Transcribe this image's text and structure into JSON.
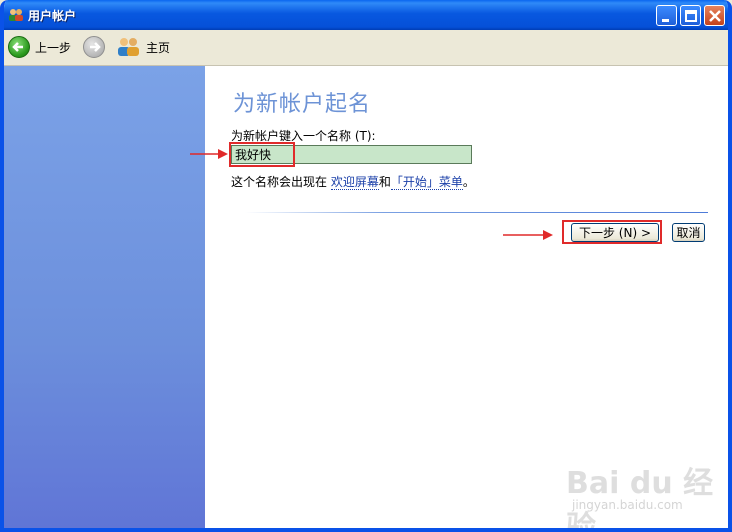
{
  "window": {
    "title": "用户帐户"
  },
  "toolbar": {
    "back_label": "上一步",
    "home_label": "主页"
  },
  "page": {
    "heading": "为新帐户起名",
    "prompt": "为新帐户键入一个名称 (T):",
    "name_value": "我好快",
    "hint_prefix": "这个名称会出现在 ",
    "hint_link1": "欢迎屏幕",
    "hint_mid": "和",
    "hint_link2": "「开始」菜单",
    "hint_suffix": "。"
  },
  "buttons": {
    "next_label": "下一步 (N) >",
    "cancel_label": "取消"
  },
  "watermark": {
    "text": "Bai du 经验",
    "sub": "jingyan.baidu.com"
  },
  "colors": {
    "titlebar": "#0550d8",
    "sidebar": "#6c8fdc",
    "heading": "#6d93d6",
    "input_bg": "#c8e6c9",
    "annotation": "#e02a2a"
  }
}
